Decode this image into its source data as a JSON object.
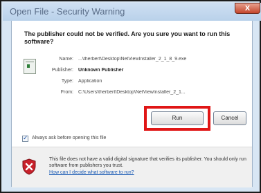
{
  "window": {
    "title": "Open File - Security Warning",
    "close_glyph": "x"
  },
  "headline": "The publisher could not be verified.  Are you sure you want to run this software?",
  "file_icon": "executable-file-icon",
  "details": [
    {
      "label": "Name:",
      "value": "...\\therbert\\Desktop\\NetViewInstaller_2_1_8_9.exe"
    },
    {
      "label": "Publisher:",
      "value": "Unknown Publisher"
    },
    {
      "label": "Type:",
      "value": "Application"
    },
    {
      "label": "From:",
      "value": "C:\\Users\\therbert\\Desktop\\NetViewInstaller_2_1..."
    }
  ],
  "buttons": {
    "run": "Run",
    "cancel": "Cancel"
  },
  "always_ask": {
    "label": "Always ask before opening this file",
    "checked": true,
    "check_glyph": "✓"
  },
  "warning": {
    "icon": "red-shield-x-icon",
    "text": "This file does not have a valid digital signature that verifies its publisher.  You should only run software from publishers you trust.",
    "link": "How can I decide what software to run?"
  },
  "colors": {
    "highlight": "#e01616",
    "link": "#1a5ab4",
    "title_bar": "#c4d8ee",
    "shield": "#c8202a"
  }
}
